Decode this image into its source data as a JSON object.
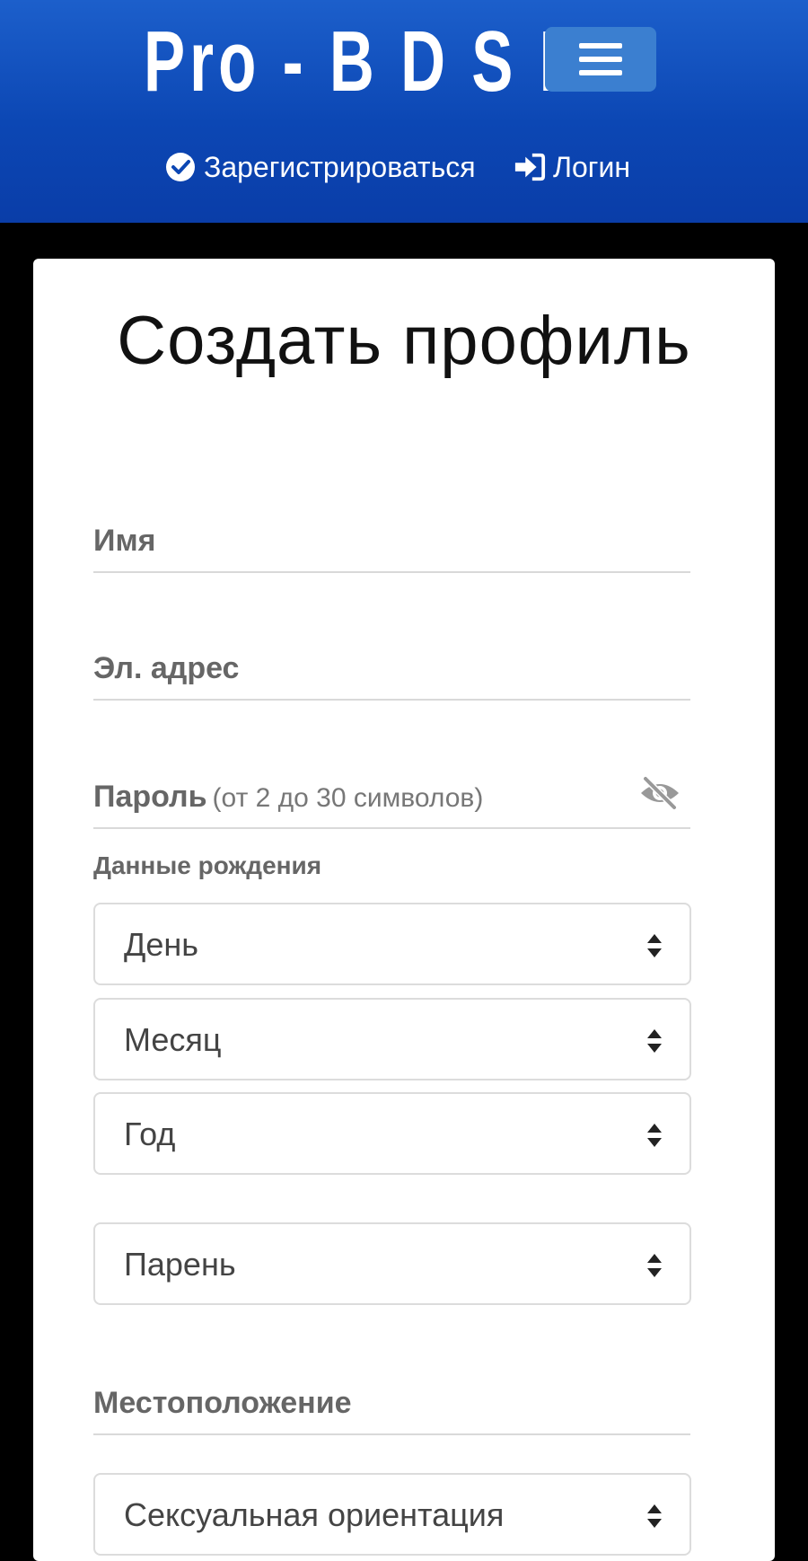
{
  "header": {
    "logo_text": "Pro - B D S M",
    "menu_icon": "hamburger-icon",
    "register_label": "Зарегистрироваться",
    "register_icon": "check-circle-icon",
    "login_label": "Логин",
    "login_icon": "sign-in-icon",
    "colors": {
      "header_bg": "#0c47b4",
      "menu_btn": "#3b7fd0"
    }
  },
  "form": {
    "title": "Создать профиль",
    "name_label": "Имя",
    "email_label": "Эл. адрес",
    "password_label": "Пароль",
    "password_hint": "(от 2 до 30 символов)",
    "password_toggle_icon": "eye-slash-icon",
    "birth_label": "Данные рождения",
    "day_select": "День",
    "month_select": "Месяц",
    "year_select": "Год",
    "gender_select": "Парень",
    "location_label": "Местоположение",
    "orientation_select": "Сексуальная ориентация"
  }
}
